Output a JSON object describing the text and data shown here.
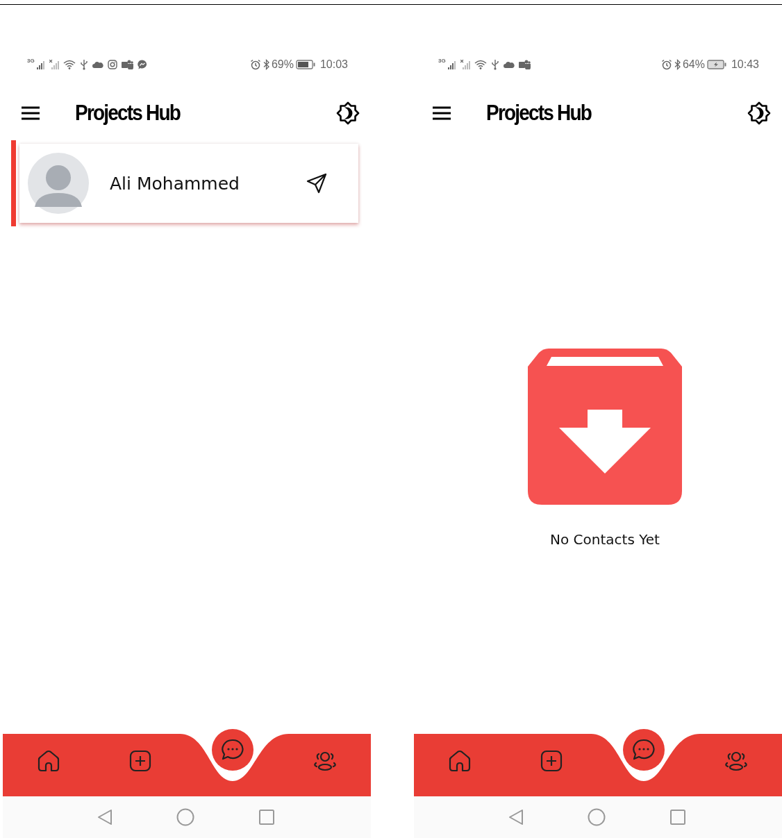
{
  "screens": [
    {
      "status": {
        "network_type": "3G",
        "notification_icons": [
          {
            "kind": "signal-3g"
          },
          {
            "kind": "signal-off"
          },
          {
            "kind": "wifi"
          },
          {
            "kind": "usb"
          },
          {
            "kind": "cloud"
          },
          {
            "kind": "instagram"
          },
          {
            "kind": "teams"
          },
          {
            "kind": "messenger"
          }
        ],
        "battery_percent": "69%",
        "charging": false,
        "time": "10:03"
      },
      "title": "Projects Hub",
      "contacts": [
        {
          "name": "Ali Mohammed"
        }
      ]
    },
    {
      "status": {
        "network_type": "3G",
        "notification_icons": [
          {
            "kind": "signal-3g"
          },
          {
            "kind": "signal-off"
          },
          {
            "kind": "wifi"
          },
          {
            "kind": "usb"
          },
          {
            "kind": "cloud"
          },
          {
            "kind": "teams"
          }
        ],
        "battery_percent": "64%",
        "charging": true,
        "time": "10:43"
      },
      "title": "Projects Hub",
      "empty_message": "No Contacts Yet"
    }
  ]
}
